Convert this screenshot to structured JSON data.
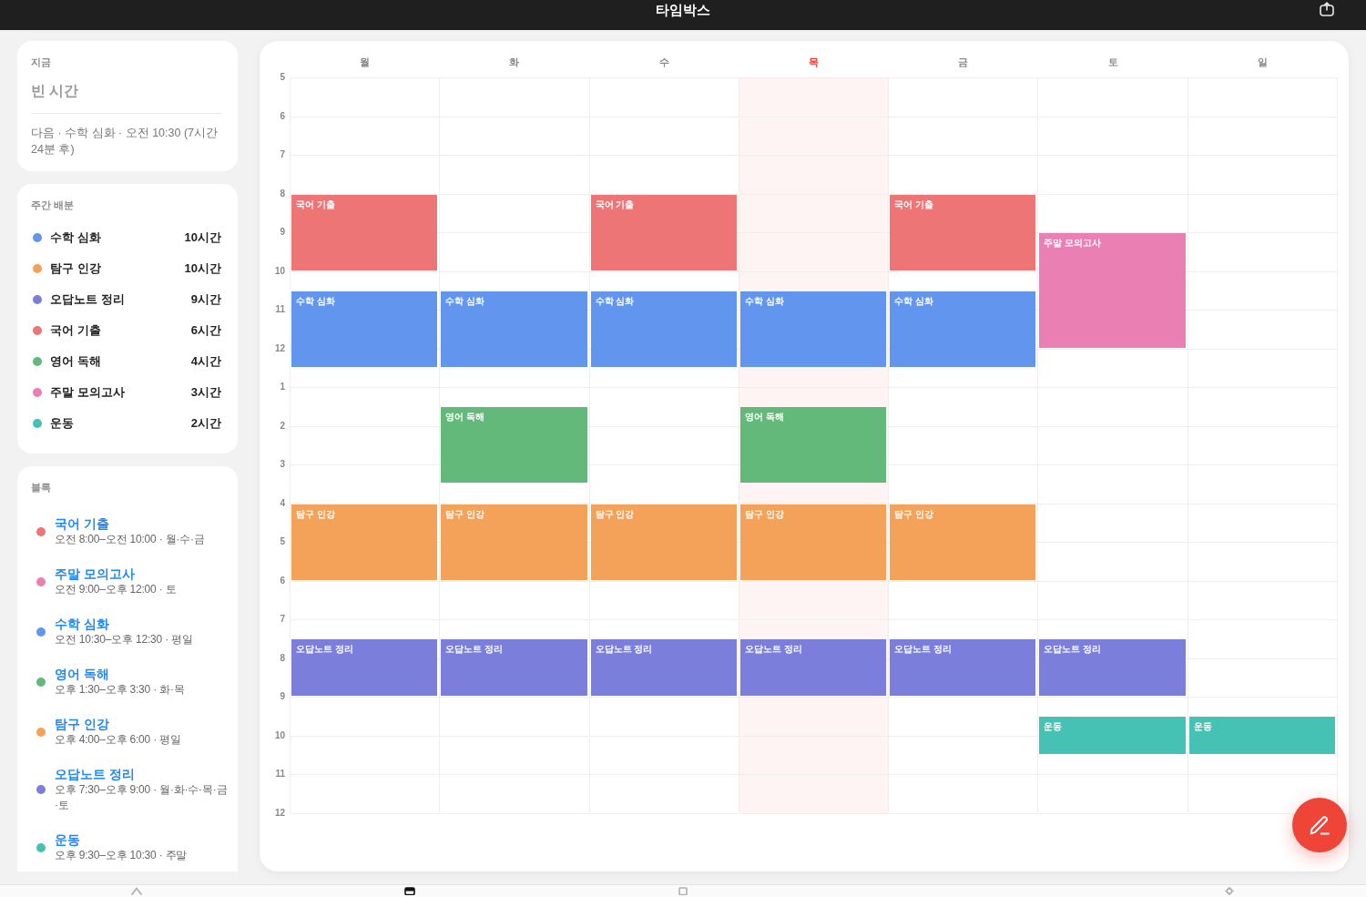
{
  "top_bar": {
    "title": "타임박스"
  },
  "now_card": {
    "label": "지금",
    "status": "빈 시간",
    "next": "다음 · 수학 심화 · 오전 10:30 (7시간 24분 후)"
  },
  "weekly_allocation": {
    "title": "주간 배분",
    "items": [
      {
        "name": "수학 심화",
        "hours": "10시간",
        "color": "#6195ee"
      },
      {
        "name": "탐구 인강",
        "hours": "10시간",
        "color": "#f4a15a"
      },
      {
        "name": "오답노트 정리",
        "hours": "9시간",
        "color": "#7b7fdb"
      },
      {
        "name": "국어 기출",
        "hours": "6시간",
        "color": "#ee7575"
      },
      {
        "name": "영어 독해",
        "hours": "4시간",
        "color": "#63b97a"
      },
      {
        "name": "주말 모의고사",
        "hours": "3시간",
        "color": "#ea7fb3"
      },
      {
        "name": "운동",
        "hours": "2시간",
        "color": "#46c2b4"
      }
    ]
  },
  "blocks": {
    "title": "블록",
    "items": [
      {
        "title": "국어 기출",
        "detail": "오전 8:00–오전 10:00 · 월·수·금",
        "color": "#ee7575"
      },
      {
        "title": "주말 모의고사",
        "detail": "오전 9:00–오후 12:00 · 토",
        "color": "#ea7fb3"
      },
      {
        "title": "수학 심화",
        "detail": "오전 10:30–오후 12:30 · 평일",
        "color": "#6195ee"
      },
      {
        "title": "영어 독해",
        "detail": "오후 1:30–오후 3:30 · 화·목",
        "color": "#63b97a"
      },
      {
        "title": "탐구 인강",
        "detail": "오후 4:00–오후 6:00 · 평일",
        "color": "#f4a15a"
      },
      {
        "title": "오답노트 정리",
        "detail": "오후 7:30–오후 9:00 · 월·화·수·목·금·토",
        "color": "#7b7fdb"
      },
      {
        "title": "운동",
        "detail": "오후 9:30–오후 10:30 · 주말",
        "color": "#46c2b4"
      }
    ]
  },
  "calendar": {
    "hours": [
      "5",
      "6",
      "7",
      "8",
      "9",
      "10",
      "11",
      "12",
      "1",
      "2",
      "3",
      "4",
      "5",
      "6",
      "7",
      "8",
      "9",
      "10",
      "11",
      "12"
    ],
    "days": [
      {
        "label": "월",
        "today": false,
        "events": [
          {
            "title": "국어 기출",
            "color": "#ee7575"
          },
          {
            "title": "수학 심화",
            "color": "#6195ee"
          },
          {
            "title": "탐구 인강",
            "color": "#f4a15a"
          },
          {
            "title": "오답노트 정리",
            "color": "#7b7fdb"
          }
        ]
      },
      {
        "label": "화",
        "today": false,
        "events": [
          {
            "title": "수학 심화",
            "color": "#6195ee"
          },
          {
            "title": "영어 독해",
            "color": "#63b97a"
          },
          {
            "title": "탐구 인강",
            "color": "#f4a15a"
          },
          {
            "title": "오답노트 정리",
            "color": "#7b7fdb"
          }
        ]
      },
      {
        "label": "수",
        "today": false,
        "events": [
          {
            "title": "국어 기출",
            "color": "#ee7575"
          },
          {
            "title": "수학 심화",
            "color": "#6195ee"
          },
          {
            "title": "탐구 인강",
            "color": "#f4a15a"
          },
          {
            "title": "오답노트 정리",
            "color": "#7b7fdb"
          }
        ]
      },
      {
        "label": "목",
        "today": true,
        "events": [
          {
            "title": "수학 심화",
            "color": "#6195ee"
          },
          {
            "title": "영어 독해",
            "color": "#63b97a"
          },
          {
            "title": "탐구 인강",
            "color": "#f4a15a"
          },
          {
            "title": "오답노트 정리",
            "color": "#7b7fdb"
          }
        ]
      },
      {
        "label": "금",
        "today": false,
        "events": [
          {
            "title": "국어 기출",
            "color": "#ee7575"
          },
          {
            "title": "수학 심화",
            "color": "#6195ee"
          },
          {
            "title": "탐구 인강",
            "color": "#f4a15a"
          },
          {
            "title": "오답노트 정리",
            "color": "#7b7fdb"
          }
        ]
      },
      {
        "label": "토",
        "today": false,
        "events": [
          {
            "title": "주말 모의고사",
            "color": "#ea7fb3"
          },
          {
            "title": "오답노트 정리",
            "color": "#7b7fdb"
          },
          {
            "title": "운동",
            "color": "#46c2b4"
          }
        ]
      },
      {
        "label": "일",
        "today": false,
        "events": [
          {
            "title": "운동",
            "color": "#46c2b4"
          }
        ]
      }
    ]
  },
  "tab_bar": {
    "tabs": [
      {
        "kind": "house",
        "selected": false
      },
      {
        "kind": "calendar",
        "selected": true
      },
      {
        "kind": "page",
        "selected": false
      },
      {
        "kind": "gear",
        "selected": false
      }
    ]
  }
}
